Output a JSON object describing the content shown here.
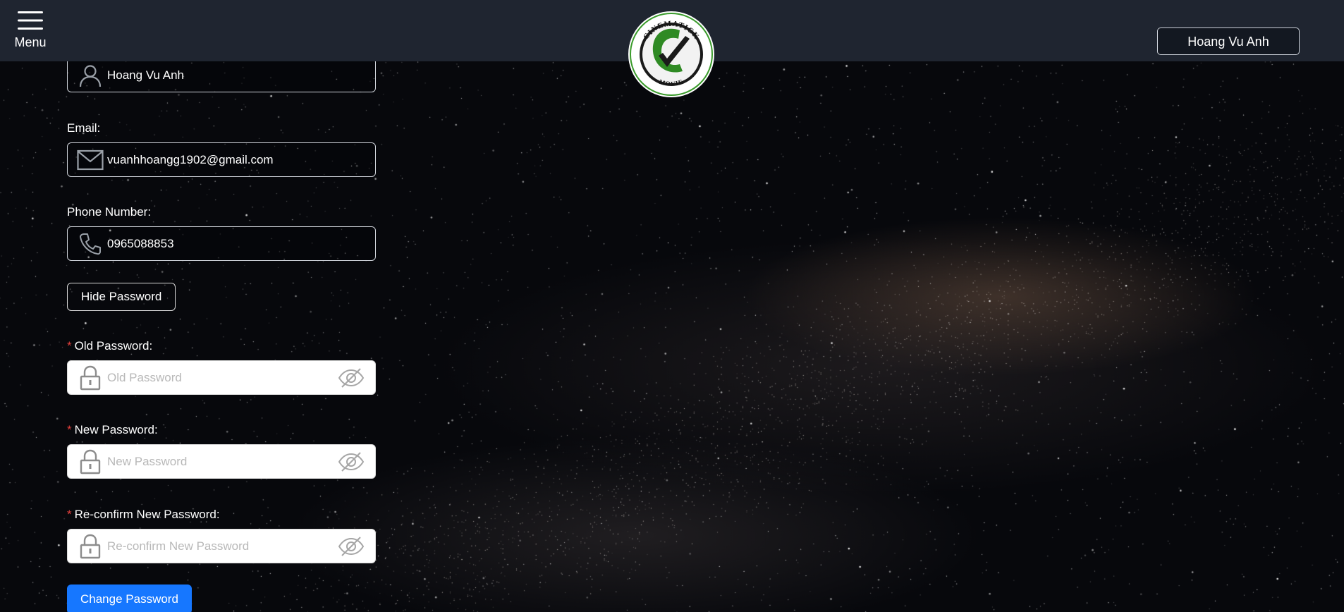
{
  "header": {
    "menu_label": "Menu",
    "logo_top_text": "CINEMATICK",
    "logo_bottom_text": "MOVIE",
    "user_button": "Hoang Vu Anh"
  },
  "form": {
    "username_value": "Hoang Vu Anh",
    "email_label": "Email",
    "email_value": "vuanhhoangg1902@gmail.com",
    "phone_label": "Phone Number",
    "phone_value": "0965088853",
    "hide_password_button": "Hide Password",
    "required_mark": "*",
    "old_password_label": "Old Password",
    "old_password_placeholder": "Old Password",
    "new_password_label": "New Password",
    "new_password_placeholder": "New Password",
    "reconfirm_label": "Re-confirm New Password",
    "reconfirm_placeholder": "Re-confirm New Password",
    "label_suffix": ":",
    "change_password_button": "Change Password"
  },
  "colors": {
    "header_bg": "#1f2530",
    "required": "#e5403c",
    "primary_button": "#1677ff",
    "logo_green": "#3a9b2b"
  }
}
